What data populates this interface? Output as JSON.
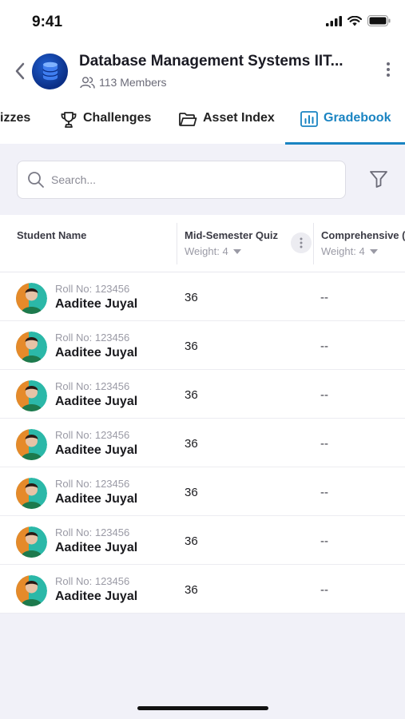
{
  "status": {
    "time": "9:41"
  },
  "header": {
    "title": "Database Management Systems IIT...",
    "members": "113 Members"
  },
  "tabs": [
    {
      "label": "izzes",
      "icon": "quiz-icon",
      "active": false
    },
    {
      "label": "Challenges",
      "icon": "trophy-icon",
      "active": false
    },
    {
      "label": "Asset Index",
      "icon": "folder-icon",
      "active": false
    },
    {
      "label": "Gradebook",
      "icon": "gradebook-chart-icon",
      "active": true
    }
  ],
  "search": {
    "placeholder": "Search..."
  },
  "table": {
    "columns": [
      {
        "label": "Student Name"
      },
      {
        "label": "Mid-Semester Quiz",
        "weight": "Weight: 4"
      },
      {
        "label": "Comprehensive (",
        "weight": "Weight: 4"
      }
    ],
    "rows": [
      {
        "roll": "Roll No: 123456",
        "name": "Aaditee Juyal",
        "mid": "36",
        "comp": "--"
      },
      {
        "roll": "Roll No: 123456",
        "name": "Aaditee Juyal",
        "mid": "36",
        "comp": "--"
      },
      {
        "roll": "Roll No: 123456",
        "name": "Aaditee Juyal",
        "mid": "36",
        "comp": "--"
      },
      {
        "roll": "Roll No: 123456",
        "name": "Aaditee Juyal",
        "mid": "36",
        "comp": "--"
      },
      {
        "roll": "Roll No: 123456",
        "name": "Aaditee Juyal",
        "mid": "36",
        "comp": "--"
      },
      {
        "roll": "Roll No: 123456",
        "name": "Aaditee Juyal",
        "mid": "36",
        "comp": "--"
      },
      {
        "roll": "Roll No: 123456",
        "name": "Aaditee Juyal",
        "mid": "36",
        "comp": "--"
      }
    ]
  },
  "colors": {
    "accent": "#1a84c2",
    "background": "#f1f1f8"
  }
}
